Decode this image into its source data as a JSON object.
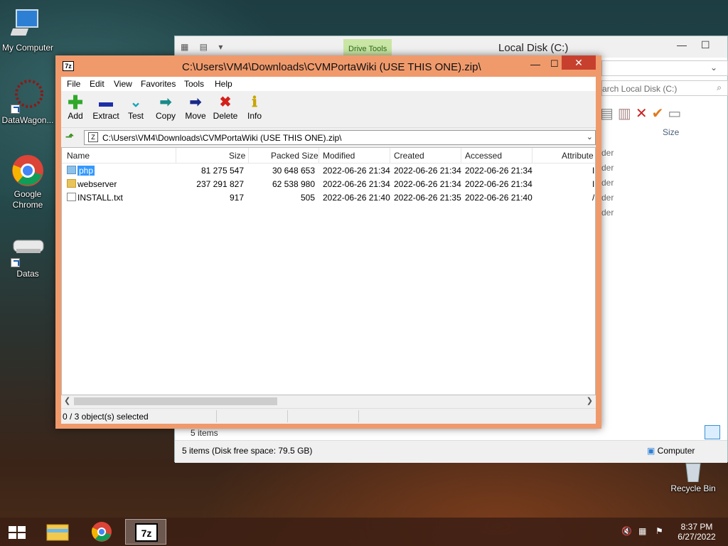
{
  "desktop": {
    "icons": [
      {
        "label": "My Computer",
        "icon": "computer-icon"
      },
      {
        "label": "DataWagon...",
        "icon": "datawagon-icon"
      },
      {
        "label": "Google Chrome",
        "icon": "chrome-icon"
      },
      {
        "label": "Datas",
        "icon": "drive-icon"
      },
      {
        "label": "Recycle Bin",
        "icon": "recycle-bin-icon"
      }
    ]
  },
  "explorer": {
    "title": "Local Disk (C:)",
    "drive_tools": "Drive Tools",
    "search_placeholder": "arch Local Disk (C:)",
    "col_size": "Size",
    "row_fragments": [
      "der",
      "der",
      "der",
      "der",
      "der"
    ],
    "items_count": "5 items",
    "status_left": "5 items (Disk free space: 79.5 GB)",
    "status_right": "Computer"
  },
  "sevenzip": {
    "title": "C:\\Users\\VM4\\Downloads\\CVMPortaWiki (USE THIS ONE).zip\\",
    "app_icon": "7z",
    "menu": [
      "File",
      "Edit",
      "View",
      "Favorites",
      "Tools",
      "Help"
    ],
    "toolbar": [
      {
        "label": "Add",
        "icon": "add-icon",
        "color": "#2fa82a"
      },
      {
        "label": "Extract",
        "icon": "extract-icon",
        "color": "#1c2fa8"
      },
      {
        "label": "Test",
        "icon": "test-icon",
        "color": "#1aa6b8"
      },
      {
        "label": "Copy",
        "icon": "copy-icon",
        "color": "#1a8a8a"
      },
      {
        "label": "Move",
        "icon": "move-icon",
        "color": "#1a2a8a"
      },
      {
        "label": "Delete",
        "icon": "delete-icon",
        "color": "#d4201a"
      },
      {
        "label": "Info",
        "icon": "info-icon",
        "color": "#c8a400"
      }
    ],
    "address": "C:\\Users\\VM4\\Downloads\\CVMPortaWiki (USE THIS ONE).zip\\",
    "columns": [
      "Name",
      "Size",
      "Packed Size",
      "Modified",
      "Created",
      "Accessed",
      "Attribute"
    ],
    "rows": [
      {
        "name": "php",
        "size": "81 275 547",
        "packed": "30 648 653",
        "modified": "2022-06-26 21:34",
        "created": "2022-06-26 21:34",
        "accessed": "2022-06-26 21:34",
        "attr": "I",
        "type": "folder",
        "selected": true
      },
      {
        "name": "webserver",
        "size": "237 291 827",
        "packed": "62 538 980",
        "modified": "2022-06-26 21:34",
        "created": "2022-06-26 21:34",
        "accessed": "2022-06-26 21:34",
        "attr": "I",
        "type": "folder",
        "selected": false
      },
      {
        "name": "INSTALL.txt",
        "size": "917",
        "packed": "505",
        "modified": "2022-06-26 21:40",
        "created": "2022-06-26 21:35",
        "accessed": "2022-06-26 21:40",
        "attr": "/",
        "type": "file",
        "selected": false
      }
    ],
    "status": "0 / 3 object(s) selected"
  },
  "taskbar": {
    "items": [
      "start-button",
      "file-explorer",
      "chrome",
      "7zip"
    ],
    "time": "8:37 PM",
    "date": "6/27/2022"
  }
}
